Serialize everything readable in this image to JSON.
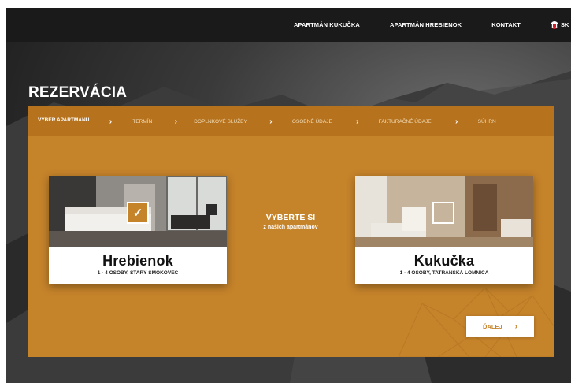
{
  "nav": {
    "items": [
      "APARTMÁN KUKUČKA",
      "APARTMÁN HREBIENOK",
      "KONTAKT"
    ],
    "lang_label": "SK",
    "lang_icon": "slovakia-flag-icon"
  },
  "page": {
    "title": "REZERVÁCIA"
  },
  "steps": [
    {
      "label": "VÝBER APARTMÁNU",
      "active": true
    },
    {
      "label": "TERMÍN",
      "active": false
    },
    {
      "label": "DOPLNKOVÉ SLUŽBY",
      "active": false
    },
    {
      "label": "OSOBNÉ ÚDAJE",
      "active": false
    },
    {
      "label": "FAKTURAČNÉ ÚDAJE",
      "active": false
    },
    {
      "label": "SÚHRN",
      "active": false
    }
  ],
  "center": {
    "title": "VYBERTE SI",
    "subtitle": "z našich apartmánov"
  },
  "apartments": [
    {
      "name": "Hrebienok",
      "details": "1 - 4 OSOBY, STARÝ SMOKOVEC",
      "selected": true
    },
    {
      "name": "Kukučka",
      "details": "1 - 4 OSOBY, TATRANSKÁ LOMNICA",
      "selected": false
    }
  ],
  "next_button": {
    "label": "ĎALEJ"
  },
  "colors": {
    "accent": "#c5832a",
    "accent_dark": "#b6721c",
    "nav_bg": "#1a1a1a"
  }
}
